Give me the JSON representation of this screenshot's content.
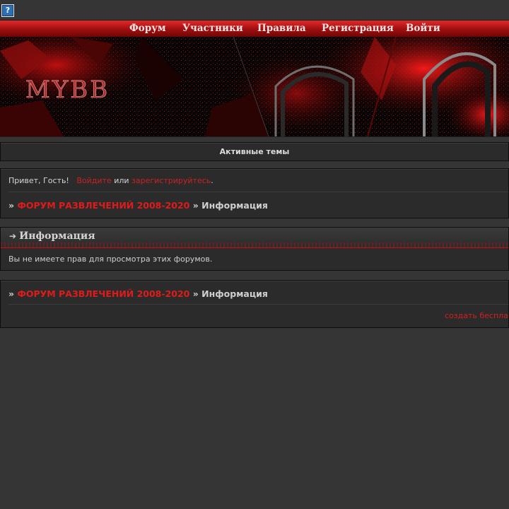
{
  "topbar": {
    "help_icon": "question-mark-icon",
    "help_glyph": "?"
  },
  "nav": {
    "items": [
      {
        "label": "Форум"
      },
      {
        "label": "Участники"
      },
      {
        "label": "Правила"
      },
      {
        "label": "Регистрация"
      },
      {
        "label": "Войти"
      }
    ]
  },
  "banner": {
    "logo_text": "MYBB"
  },
  "active_topics": {
    "label": "Активные темы"
  },
  "welcome": {
    "greeting": "Привет, Гость!",
    "login_link": "Войдите",
    "or_text": "или",
    "register_link": "зарегистрируйтесь",
    "period": "."
  },
  "breadcrumb": {
    "prefix": "»",
    "forum_link": "ФОРУМ РАЗВЛЕЧЕНИЙ 2008-2020",
    "separator": "»",
    "current": "Информация"
  },
  "info": {
    "title": "Информация",
    "title_icon": "arrow-right-icon",
    "message": "Вы не имеете прав для просмотра этих форумов."
  },
  "footer": {
    "create_link": "создать беспла"
  },
  "colors": {
    "accent": "#d12020",
    "nav_red": "#a60f0f",
    "background": "#353535"
  }
}
